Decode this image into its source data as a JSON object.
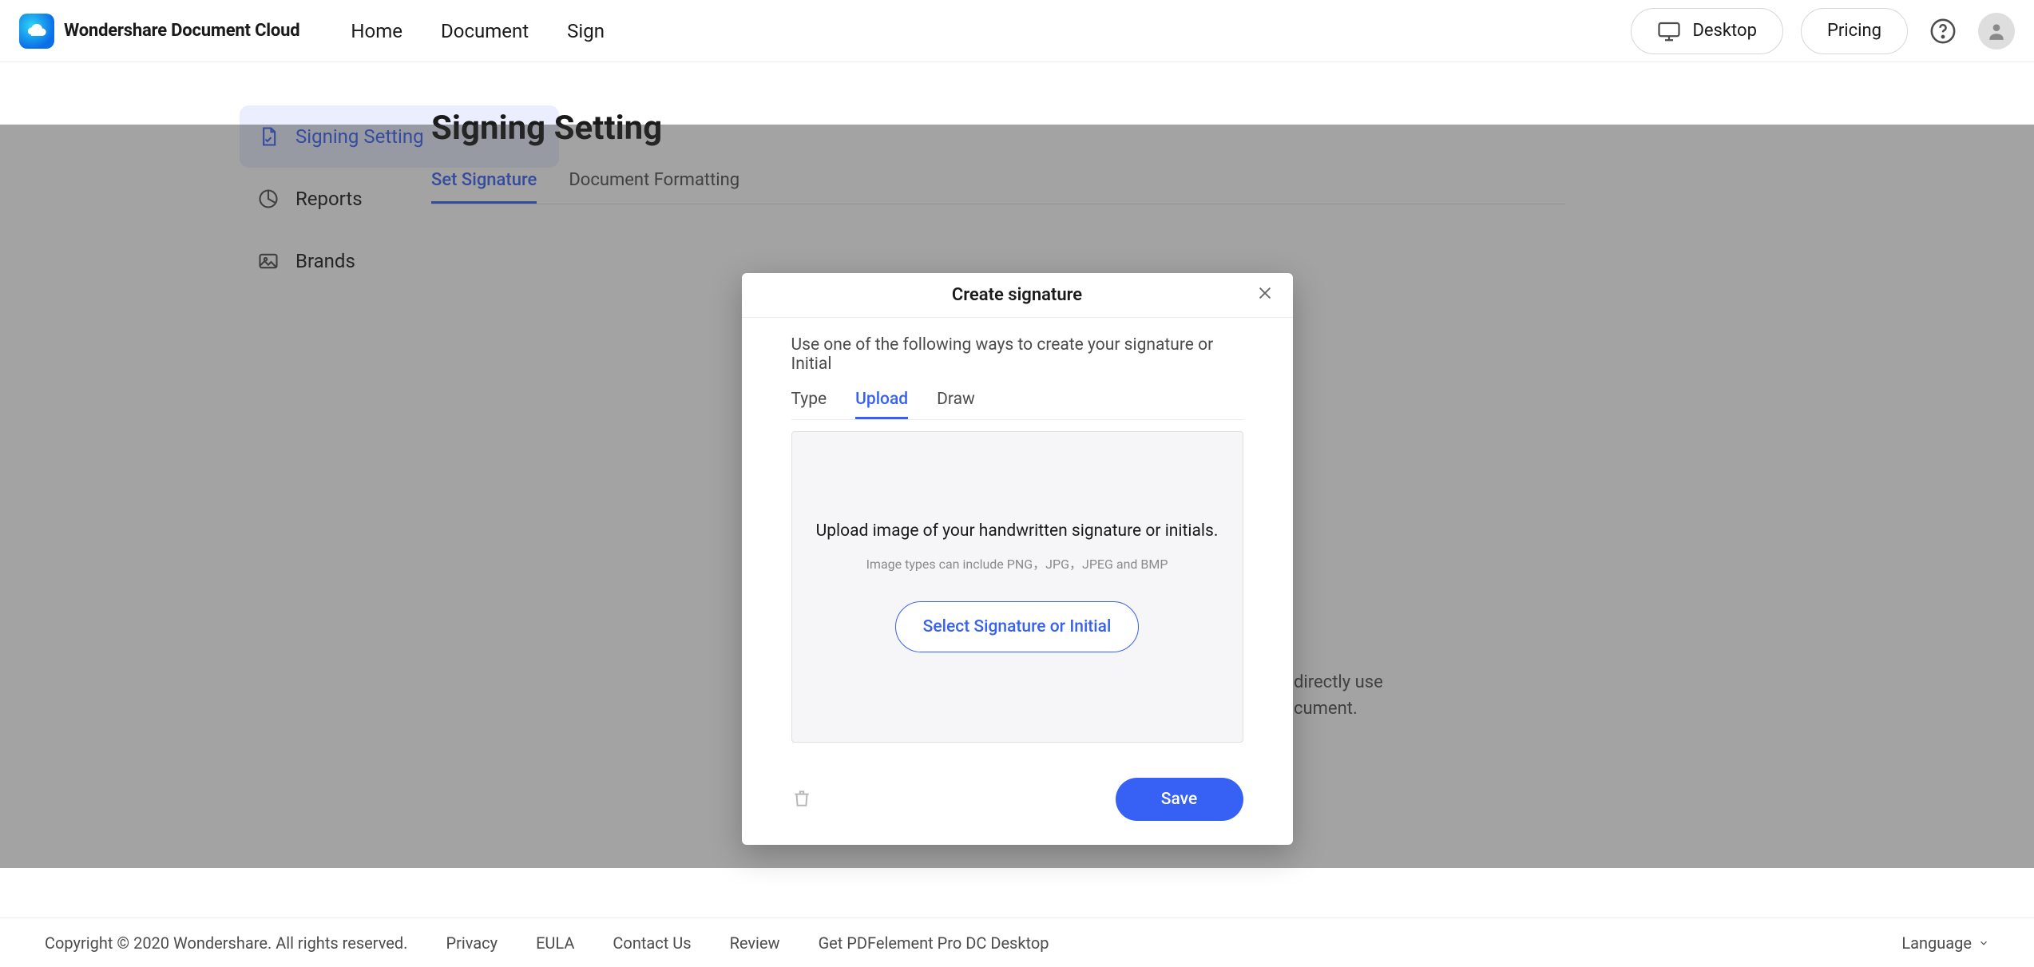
{
  "brand": {
    "name": "Wondershare Document Cloud"
  },
  "nav": {
    "home": "Home",
    "document": "Document",
    "sign": "Sign"
  },
  "header_buttons": {
    "desktop": "Desktop",
    "pricing": "Pricing"
  },
  "sidebar": {
    "signing_setting": "Signing Setting",
    "reports": "Reports",
    "brands": "Brands"
  },
  "page": {
    "title": "Signing Setting",
    "tabs": {
      "set_signature": "Set Signature",
      "document_formatting": "Document Formatting"
    },
    "bg_hint_line1": "directly use",
    "bg_hint_line2": "cument."
  },
  "modal": {
    "title": "Create signature",
    "instruction": "Use one of the following ways to create your signature or Initial",
    "tabs": {
      "type": "Type",
      "upload": "Upload",
      "draw": "Draw"
    },
    "upload": {
      "line1": "Upload image of your handwritten signature or initials.",
      "line2": "Image types can include PNG，JPG，JPEG and BMP",
      "select_button": "Select Signature or Initial"
    },
    "save": "Save"
  },
  "footer": {
    "copyright": "Copyright © 2020 Wondershare. All rights reserved.",
    "privacy": "Privacy",
    "eula": "EULA",
    "contact": "Contact Us",
    "review": "Review",
    "get_desktop": "Get PDFelement Pro DC Desktop",
    "language": "Language"
  },
  "colors": {
    "primary": "#3760F4"
  }
}
